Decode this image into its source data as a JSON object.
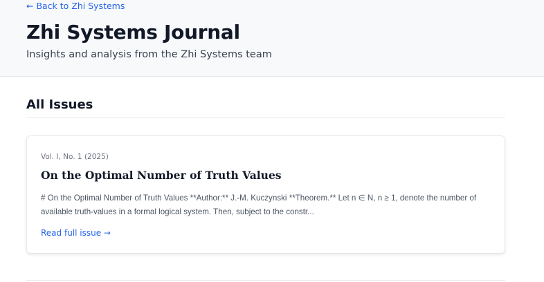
{
  "header": {
    "back_link": "← Back to Zhi Systems",
    "title": "Zhi Systems Journal",
    "subtitle": "Insights and analysis from the Zhi Systems team"
  },
  "main": {
    "section_title": "All Issues",
    "issues": [
      {
        "meta": "Vol. I, No. 1 (2025)",
        "title": "On the Optimal Number of Truth Values",
        "excerpt": "# On the Optimal Number of Truth Values **Author:** J.-M. Kuczynski **Theorem.** Let n ∈ N, n ≥ 1, denote the number of available truth-values in a formal logical system. Then, subject to the constr...",
        "link": "Read full issue →"
      }
    ]
  }
}
